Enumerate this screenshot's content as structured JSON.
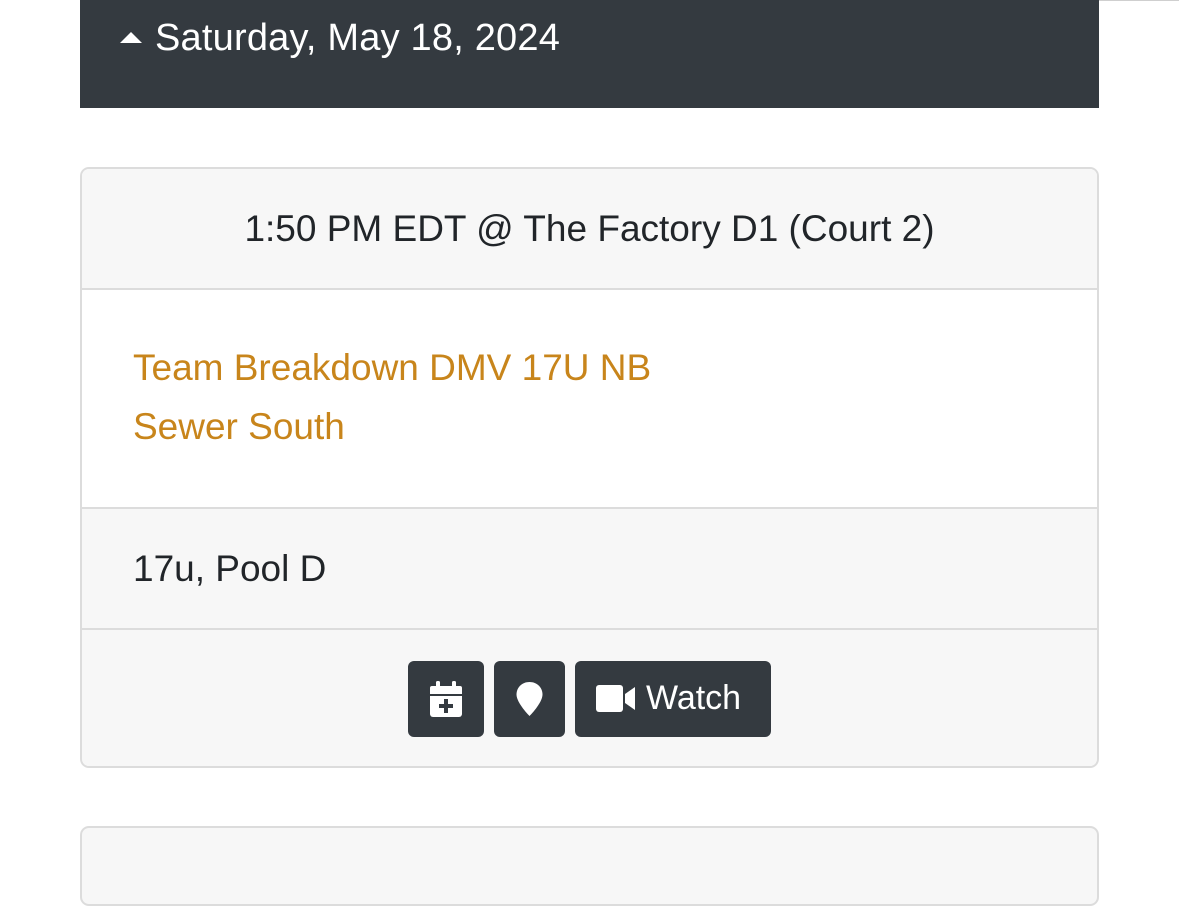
{
  "day_header": {
    "title": "Saturday, May 18, 2024",
    "icon": "caret-up-icon"
  },
  "game": {
    "time_venue": "1:50 PM EDT @ The Factory D1 (Court 2)",
    "teams": [
      "Team Breakdown DMV 17U NB",
      "Sewer South"
    ],
    "division": "17u, Pool D",
    "actions": {
      "calendar_icon": "calendar-plus-icon",
      "map_icon": "map-marker-icon",
      "watch_icon": "video-camera-icon",
      "watch_label": "Watch"
    }
  },
  "colors": {
    "header_bg": "#343a40",
    "team_link": "#c8851b",
    "card_bg": "#f7f7f7",
    "border": "#dcdcdc"
  }
}
